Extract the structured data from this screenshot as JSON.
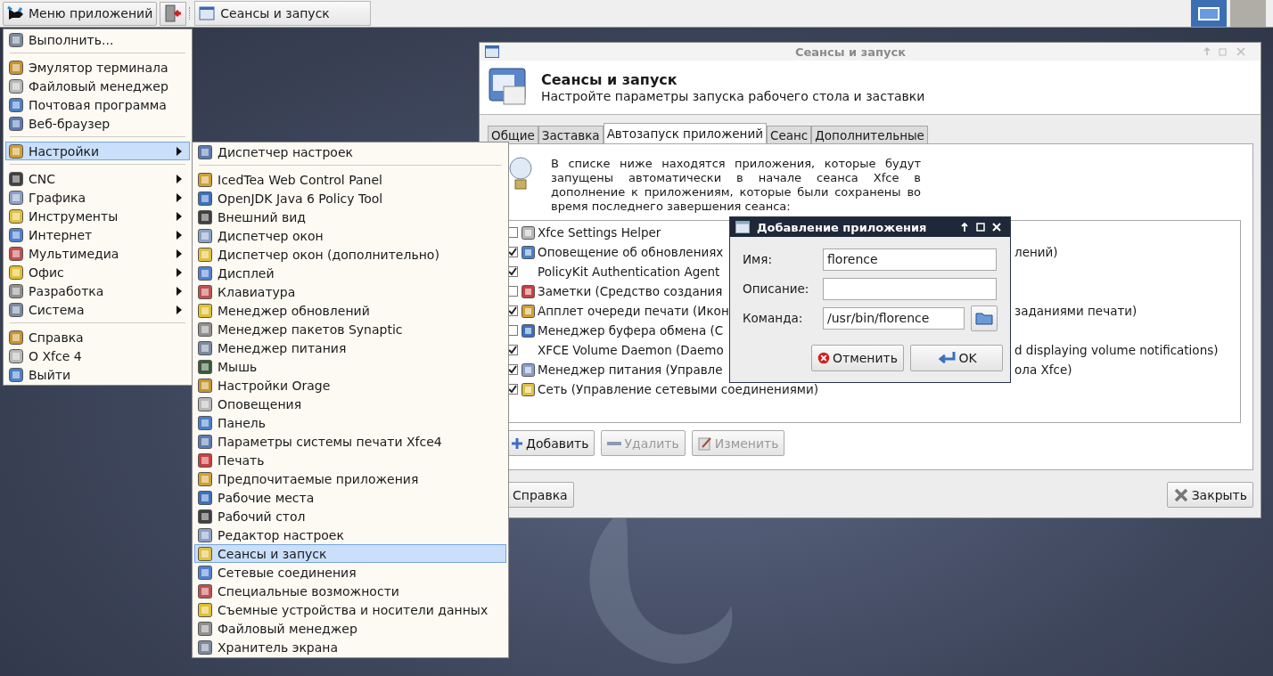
{
  "panel": {
    "app_menu_button": "Меню приложений",
    "tasks": [
      {
        "label": "Сеансы и запуск",
        "selected": false
      }
    ],
    "workspaces": [
      {
        "selected": true
      },
      {
        "selected": false
      }
    ]
  },
  "app_menu": {
    "items": [
      {
        "kind": "item",
        "label": "Выполнить...",
        "submenu": false,
        "selected": false
      },
      {
        "kind": "separator"
      },
      {
        "kind": "item",
        "label": "Эмулятор терминала",
        "submenu": false,
        "selected": false
      },
      {
        "kind": "item",
        "label": "Файловый менеджер",
        "submenu": false,
        "selected": false
      },
      {
        "kind": "item",
        "label": "Почтовая программа",
        "submenu": false,
        "selected": false
      },
      {
        "kind": "item",
        "label": "Веб-браузер",
        "submenu": false,
        "selected": false
      },
      {
        "kind": "separator"
      },
      {
        "kind": "item",
        "label": "Настройки",
        "submenu": true,
        "selected": true
      },
      {
        "kind": "separator"
      },
      {
        "kind": "item",
        "label": "CNC",
        "submenu": true,
        "selected": false
      },
      {
        "kind": "item",
        "label": "Графика",
        "submenu": true,
        "selected": false
      },
      {
        "kind": "item",
        "label": "Инструменты",
        "submenu": true,
        "selected": false
      },
      {
        "kind": "item",
        "label": "Интернет",
        "submenu": true,
        "selected": false
      },
      {
        "kind": "item",
        "label": "Мультимедиа",
        "submenu": true,
        "selected": false
      },
      {
        "kind": "item",
        "label": "Офис",
        "submenu": true,
        "selected": false
      },
      {
        "kind": "item",
        "label": "Разработка",
        "submenu": true,
        "selected": false
      },
      {
        "kind": "item",
        "label": "Система",
        "submenu": true,
        "selected": false
      },
      {
        "kind": "separator"
      },
      {
        "kind": "item",
        "label": "Справка",
        "submenu": false,
        "selected": false
      },
      {
        "kind": "item",
        "label": "О Xfce 4",
        "submenu": false,
        "selected": false
      },
      {
        "kind": "item",
        "label": "Выйти",
        "submenu": false,
        "selected": false
      }
    ]
  },
  "settings_submenu": {
    "items": [
      {
        "kind": "item",
        "label": "Диспетчер настроек",
        "selected": false
      },
      {
        "kind": "separator"
      },
      {
        "kind": "item",
        "label": "IcedTea Web Control Panel",
        "selected": false
      },
      {
        "kind": "item",
        "label": "OpenJDK Java 6 Policy Tool",
        "selected": false
      },
      {
        "kind": "item",
        "label": "Внешний вид",
        "selected": false
      },
      {
        "kind": "item",
        "label": "Диспетчер окон",
        "selected": false
      },
      {
        "kind": "item",
        "label": "Диспетчер окон (дополнительно)",
        "selected": false
      },
      {
        "kind": "item",
        "label": "Дисплей",
        "selected": false
      },
      {
        "kind": "item",
        "label": "Клавиатура",
        "selected": false
      },
      {
        "kind": "item",
        "label": "Менеджер обновлений",
        "selected": false
      },
      {
        "kind": "item",
        "label": "Менеджер пакетов Synaptic",
        "selected": false
      },
      {
        "kind": "item",
        "label": "Менеджер питания",
        "selected": false
      },
      {
        "kind": "item",
        "label": "Мышь",
        "selected": false
      },
      {
        "kind": "item",
        "label": "Настройки Orage",
        "selected": false
      },
      {
        "kind": "item",
        "label": "Оповещения",
        "selected": false
      },
      {
        "kind": "item",
        "label": "Панель",
        "selected": false
      },
      {
        "kind": "item",
        "label": "Параметры системы печати Xfce4",
        "selected": false
      },
      {
        "kind": "item",
        "label": "Печать",
        "selected": false
      },
      {
        "kind": "item",
        "label": "Предпочитаемые приложения",
        "selected": false
      },
      {
        "kind": "item",
        "label": "Рабочие места",
        "selected": false
      },
      {
        "kind": "item",
        "label": "Рабочий стол",
        "selected": false
      },
      {
        "kind": "item",
        "label": "Редактор настроек",
        "selected": false
      },
      {
        "kind": "item",
        "label": "Сеансы и запуск",
        "selected": true
      },
      {
        "kind": "item",
        "label": "Сетевые соединения",
        "selected": false
      },
      {
        "kind": "item",
        "label": "Специальные возможности",
        "selected": false
      },
      {
        "kind": "item",
        "label": "Съемные устройства и носители данных",
        "selected": false
      },
      {
        "kind": "item",
        "label": "Файловый менеджер",
        "selected": false
      },
      {
        "kind": "item",
        "label": "Хранитель экрана",
        "selected": false
      }
    ]
  },
  "window": {
    "title": "Сеансы и запуск",
    "heading": "Сеансы и запуск",
    "subtitle": "Настройте параметры запуска рабочего стола и заставки",
    "tabs": [
      {
        "label": "Общие",
        "selected": false
      },
      {
        "label": "Заставка",
        "selected": false
      },
      {
        "label": "Автозапуск приложений",
        "selected": true
      },
      {
        "label": "Сеанс",
        "selected": false
      },
      {
        "label": "Дополнительные",
        "selected": false
      }
    ],
    "info": "В списке ниже находятся приложения, которые будут запущены автоматически в начале сеанса Xfce в дополнение к приложениям, которые были сохранены во время последнего завершения сеанса:",
    "apps": [
      {
        "name": "Xfce Settings Helper",
        "checked": false,
        "has_icon": true
      },
      {
        "name": "Оповещение об обновлениях",
        "tail": "лений)",
        "checked": true,
        "has_icon": true
      },
      {
        "name": "PolicyKit Authentication Agent",
        "checked": true,
        "has_icon": false
      },
      {
        "name": "Заметки (Средство создания",
        "checked": false,
        "has_icon": true
      },
      {
        "name": "Апплет очереди печати (Икон",
        "tail": "заданиями печати)",
        "checked": true,
        "has_icon": true
      },
      {
        "name": "Менеджер буфера обмена (С",
        "checked": false,
        "has_icon": true
      },
      {
        "name": "XFCE Volume Daemon (Daemo",
        "tail": "d displaying volume notifications)",
        "checked": true,
        "has_icon": false
      },
      {
        "name": "Менеджер питания (Управле",
        "tail": "ола Xfce)",
        "checked": true,
        "has_icon": true
      },
      {
        "name": "Сеть (Управление сетевыми соединениями)",
        "checked": true,
        "has_icon": true
      }
    ],
    "list_buttons": [
      {
        "label": "Добавить",
        "disabled": false
      },
      {
        "label": "Удалить",
        "disabled": true
      },
      {
        "label": "Изменить",
        "disabled": true
      }
    ],
    "help_button": "Справка",
    "close_button": "Закрыть"
  },
  "dialog": {
    "title": "Добавление приложения",
    "fields": [
      {
        "label": "Имя:",
        "value": "florence"
      },
      {
        "label": "Описание:"
      },
      {
        "label": "Команда:",
        "value": "/usr/bin/florence"
      }
    ],
    "cancel_button": "Отменить",
    "ok_button": "OK"
  }
}
